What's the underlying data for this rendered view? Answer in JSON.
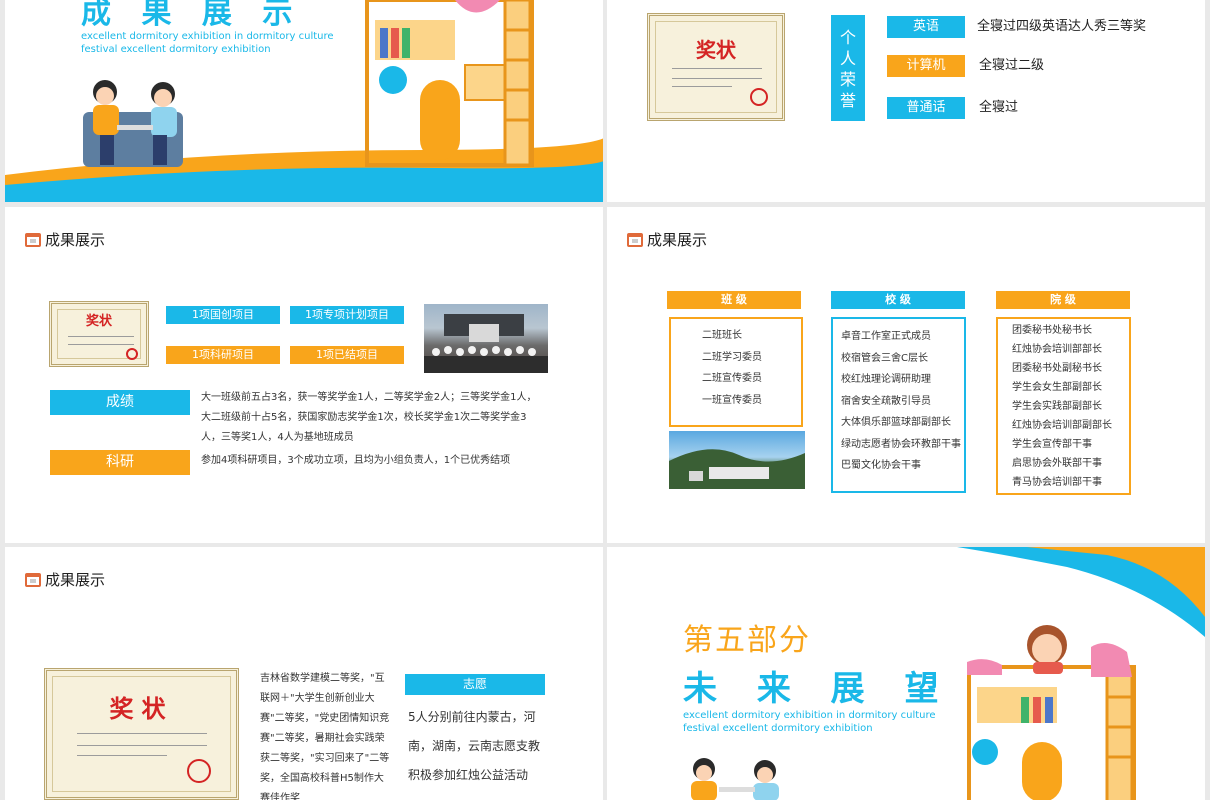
{
  "slide1": {
    "title_chars": "成 果 展 示",
    "subtitle_line1": "excellent dormitory exhibition in dormitory culture",
    "subtitle_line2": "festival excellent dormitory exhibition"
  },
  "slide2": {
    "certificate_title": "奖状",
    "vertical_label": "个人荣誉",
    "honors": [
      {
        "tag": "英语",
        "text": "全寝过四级英语达人秀三等奖"
      },
      {
        "tag": "计算机",
        "text": "全寝过二级"
      },
      {
        "tag": "普通话",
        "text": "全寝过"
      }
    ]
  },
  "slide3": {
    "title": "成果展示",
    "certificate_title": "奖状",
    "tags": [
      "1项国创项目",
      "1项专项计划项目",
      "1项科研项目",
      "1项已结项目"
    ],
    "grades_label": "成绩",
    "grades_text": "大一班级前五占3名，获一等奖学金1人，二等奖学金2人；三等奖学金1人，大二班级前十占5名，获国家励志奖学金1次，校长奖学金1次二等奖学金3人，三等奖1人，4人为基地班成员",
    "research_label": "科研",
    "research_text": "参加4项科研项目，3个成功立项，且均为小组负责人，1个已优秀结项"
  },
  "slide4": {
    "title": "成果展示",
    "columns": [
      {
        "header": "班 级",
        "items": [
          "二班班长",
          "二班学习委员",
          "二班宣传委员",
          "一班宣传委员"
        ]
      },
      {
        "header": "校 级",
        "items": [
          "卓音工作室正式成员",
          "校宿管会三舍C层长",
          "校红烛理论调研助理",
          "宿舍安全疏散引导员",
          "大体俱乐部篮球部副部长",
          "绿动志愿者协会环教部干事",
          "巴蜀文化协会干事"
        ]
      },
      {
        "header": "院 级",
        "items": [
          "团委秘书处秘书长",
          "红烛协会培训部部长",
          "团委秘书处副秘书长",
          "学生会女生部副部长",
          "学生会实践部副部长",
          "红烛协会培训部副部长",
          "学生会宣传部干事",
          "启思协会外联部干事",
          "青马协会培训部干事"
        ]
      }
    ]
  },
  "slide5": {
    "title": "成果展示",
    "certificate_title": "奖状",
    "awards_text": "吉林省数学建模二等奖，\"互联网＋\"大学生创新创业大赛\"二等奖，\"党史团情知识竞赛\"二等奖，暑期社会实践荣获二等奖，\"实习回来了\"二等奖，全国高校科普H5制作大赛佳作奖",
    "volunteer_tag": "志愿",
    "volunteer_text": "5人分别前往内蒙古，河南，湖南，云南志愿支教积极参加红烛公益活动"
  },
  "slide6": {
    "part": "第五部分",
    "heading": "未 来 展 望",
    "subtitle_line1": "excellent dormitory exhibition in dormitory culture",
    "subtitle_line2": "festival excellent dormitory exhibition"
  },
  "colors": {
    "blue": "#1ab8e8",
    "orange": "#f9a51b",
    "red": "#d42424"
  }
}
